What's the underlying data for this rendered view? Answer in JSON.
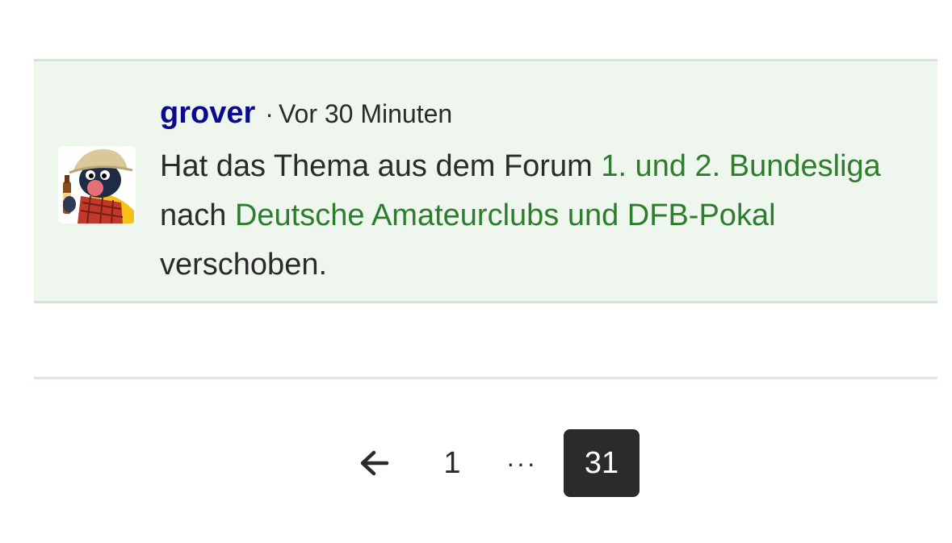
{
  "post": {
    "username": "grover",
    "separator": "·",
    "time": "Vor 30 Minuten",
    "message": {
      "part1": "Hat das Thema aus dem Forum ",
      "link_from": "1. und 2. Bundesliga",
      "part2": " nach ",
      "link_to": "Deutsche Amateurclubs und DFB-Pokal",
      "part3": " verschoben."
    }
  },
  "pagination": {
    "prev_icon": "arrow-left-icon",
    "first_page": "1",
    "ellipsis": "···",
    "current_page": "31"
  },
  "colors": {
    "post_background": "#eef6ee",
    "username": "#0a0a8c",
    "link": "#2e7d2e",
    "current_page_bg": "#2b2b2b"
  }
}
